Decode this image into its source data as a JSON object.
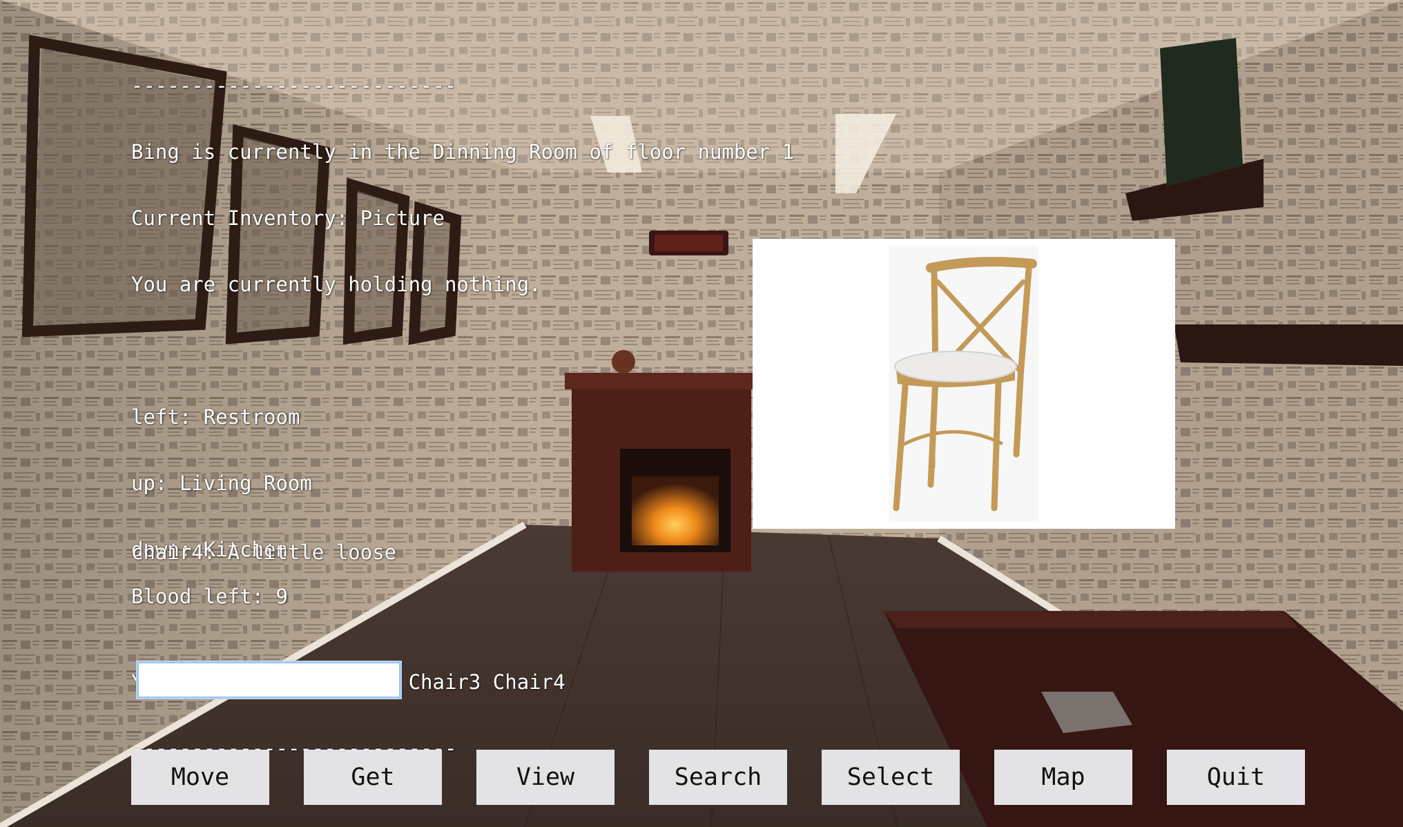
{
  "status": {
    "divider_top": "---------------------------",
    "location_line": "Bing is currently in the Dinning Room of floor number 1",
    "inventory_line": "Current Inventory: Picture",
    "holding_line": "You are currently holding nothing.",
    "exits": [
      "left: Restroom",
      "up: Living Room",
      "down: Kitchen"
    ],
    "you_see_line": "You see: Chair1 Chair2 Chair3 Chair4",
    "divider_bottom": "---------------------------"
  },
  "message": {
    "description": "chair4: A little loose",
    "blood": "Blood left: 9"
  },
  "item_image": {
    "subject": "wooden cross-back chair with white cushion",
    "icon": "chair-image"
  },
  "input": {
    "value": "",
    "placeholder": ""
  },
  "buttons": {
    "move": "Move",
    "get": "Get",
    "view": "View",
    "search": "Search",
    "select": "Select",
    "map": "Map",
    "quit": "Quit"
  },
  "colors": {
    "text": "#ffffff",
    "button_bg": "#e3e3e6",
    "input_border": "#9ec3ea",
    "panel_bg": "#ffffff"
  }
}
